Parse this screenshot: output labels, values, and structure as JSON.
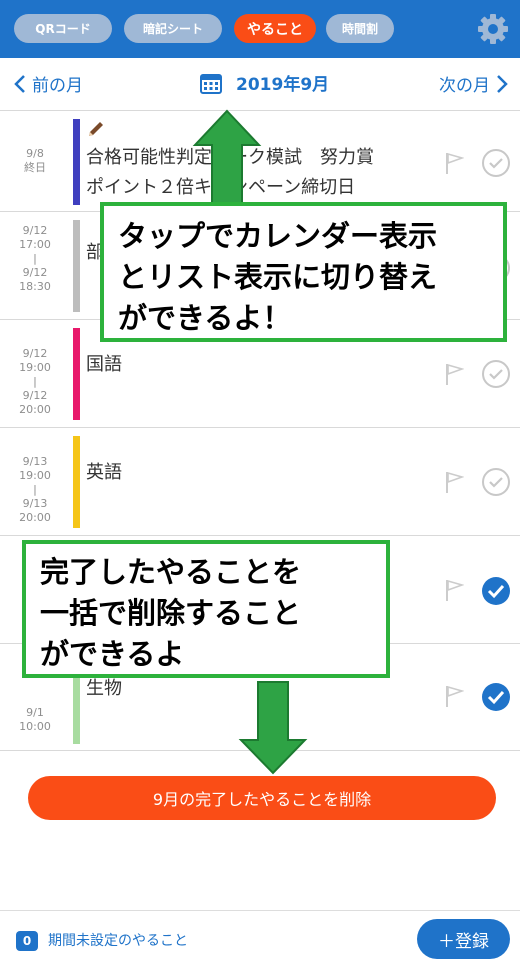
{
  "tabs": [
    {
      "label": "QRコード",
      "active": false
    },
    {
      "label": "暗記シート",
      "active": false
    },
    {
      "label": "やること",
      "active": true
    },
    {
      "label": "時間割",
      "active": false
    }
  ],
  "nav": {
    "prev_label": "前の月",
    "next_label": "次の月",
    "month_title": "2019年9月"
  },
  "todos": [
    {
      "date_lines": [
        "9/8",
        "終日"
      ],
      "title_lines": [
        "合格可能性判定マーク模試　努力賞",
        "ポイント２倍キャンペーン締切日"
      ],
      "color": "#3f3fbf",
      "done": false,
      "edit_icon": true
    },
    {
      "date_lines": [
        "9/12",
        "17:00",
        "|",
        "9/12",
        "18:30"
      ],
      "title_lines": [
        "部活"
      ],
      "color": "#bdbdbd",
      "done": false,
      "edit_icon": false
    },
    {
      "date_lines": [
        "9/12",
        "19:00",
        "|",
        "9/12",
        "20:00"
      ],
      "title_lines": [
        "国語"
      ],
      "color": "#e8196b",
      "done": false,
      "edit_icon": false
    },
    {
      "date_lines": [
        "9/13",
        "19:00",
        "|",
        "9/13",
        "20:00"
      ],
      "title_lines": [
        "英語"
      ],
      "color": "#f5c518",
      "done": false,
      "edit_icon": false
    },
    {
      "date_lines": [],
      "title_lines": [],
      "color": "#f08a24",
      "done": true,
      "edit_icon": false
    },
    {
      "date_lines": [
        "9/1",
        "10:00"
      ],
      "title_lines": [
        "生物"
      ],
      "color": "#a8dca0",
      "done": true,
      "edit_icon": false
    }
  ],
  "delete_button_label": "9月の完了したやることを削除",
  "bottom": {
    "unset_count": "0",
    "unset_label": "期間未設定のやること",
    "register_label": "＋登録"
  },
  "callouts": {
    "calendar_toggle": [
      "タップでカレンダー表示",
      "とリスト表示に切り替え",
      "ができるよ！"
    ],
    "bulk_delete": [
      "完了したやることを",
      "一括で削除すること",
      "ができるよ"
    ]
  },
  "colors": {
    "brand_blue": "#1f73c9",
    "accent_orange": "#fa4d16",
    "callout_green": "#2db23c",
    "inactive_tab": "#9fb8d6"
  }
}
